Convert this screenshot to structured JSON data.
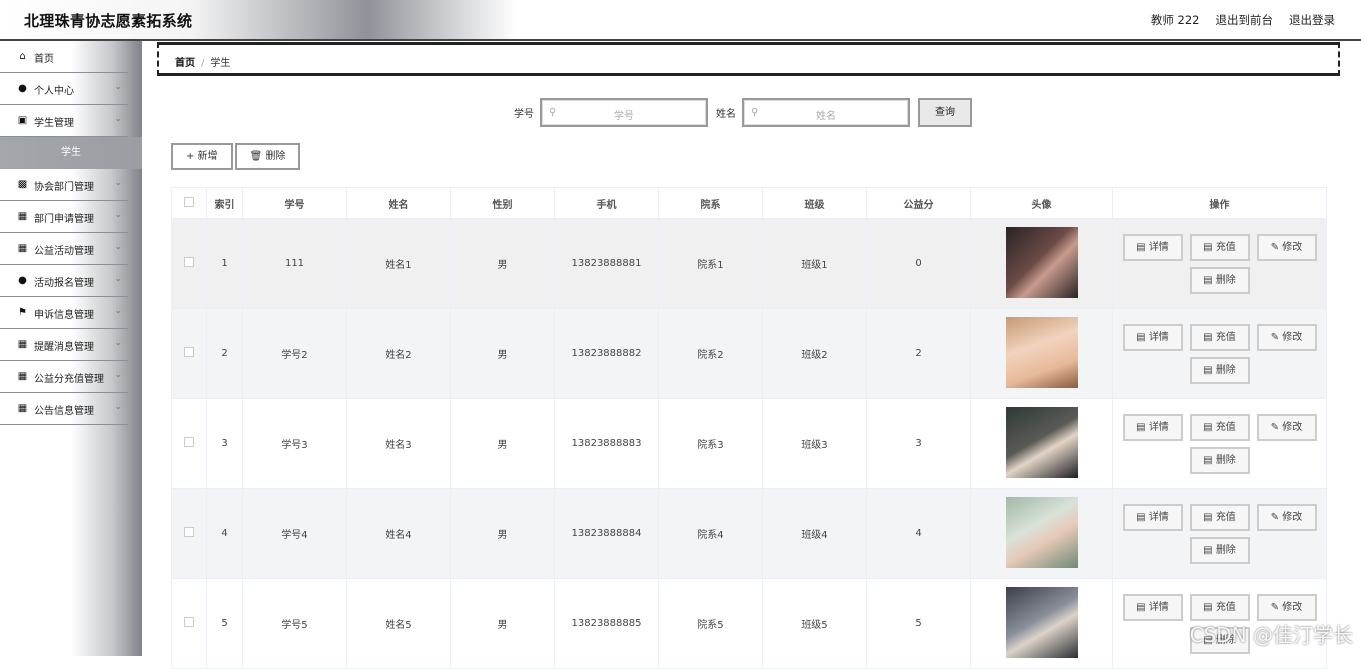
{
  "header": {
    "title": "北理珠青协志愿素拓系统",
    "user": "教师 222",
    "front": "退出到前台",
    "logout": "退出登录"
  },
  "sidebar": {
    "items": [
      {
        "label": "首页",
        "icon": "home-icon",
        "chevron": false
      },
      {
        "label": "个人中心",
        "icon": "person-icon",
        "chevron": true
      },
      {
        "label": "学生管理",
        "icon": "thumb-icon",
        "chevron": true
      }
    ],
    "sub_active": "学生",
    "items2": [
      {
        "label": "协会部门管理",
        "icon": "clipboard-icon"
      },
      {
        "label": "部门申请管理",
        "icon": "grid-icon"
      },
      {
        "label": "公益活动管理",
        "icon": "grid-icon"
      },
      {
        "label": "活动报名管理",
        "icon": "person-icon"
      },
      {
        "label": "申诉信息管理",
        "icon": "flag-icon"
      },
      {
        "label": "提醒消息管理",
        "icon": "grid-icon"
      },
      {
        "label": "公益分充值管理",
        "icon": "grid-icon"
      },
      {
        "label": "公告信息管理",
        "icon": "grid-icon"
      }
    ]
  },
  "breadcrumb": {
    "home": "首页",
    "sep": "/",
    "current": "学生"
  },
  "search": {
    "label1": "学号",
    "placeholder1": "学号",
    "label2": "姓名",
    "placeholder2": "姓名",
    "button": "查询"
  },
  "actions": {
    "add": "+ 新增",
    "delete": "删除"
  },
  "table": {
    "headers": [
      "索引",
      "学号",
      "姓名",
      "性别",
      "手机",
      "院系",
      "班级",
      "公益分",
      "头像",
      "操作"
    ],
    "rows": [
      {
        "idx": "1",
        "sid": "111",
        "name": "姓名1",
        "sex": "男",
        "phone": "13823888881",
        "dept": "院系1",
        "cls": "班级1",
        "score": "0"
      },
      {
        "idx": "2",
        "sid": "学号2",
        "name": "姓名2",
        "sex": "男",
        "phone": "13823888882",
        "dept": "院系2",
        "cls": "班级2",
        "score": "2"
      },
      {
        "idx": "3",
        "sid": "学号3",
        "name": "姓名3",
        "sex": "男",
        "phone": "13823888883",
        "dept": "院系3",
        "cls": "班级3",
        "score": "3"
      },
      {
        "idx": "4",
        "sid": "学号4",
        "name": "姓名4",
        "sex": "男",
        "phone": "13823888884",
        "dept": "院系4",
        "cls": "班级4",
        "score": "4"
      },
      {
        "idx": "5",
        "sid": "学号5",
        "name": "姓名5",
        "sex": "男",
        "phone": "13823888885",
        "dept": "院系5",
        "cls": "班级5",
        "score": "5"
      }
    ],
    "ops": {
      "detail": "详情",
      "recharge": "充值",
      "edit": "修改",
      "delete": "删除"
    }
  },
  "watermark": "CSDN @佳汀学长"
}
